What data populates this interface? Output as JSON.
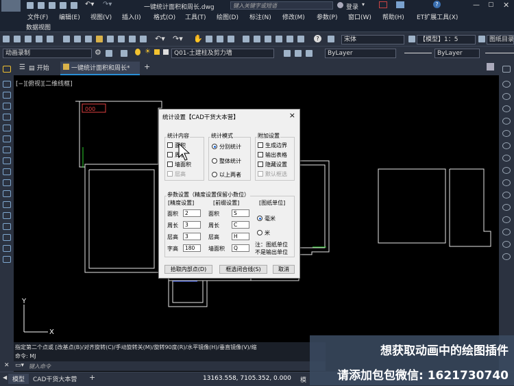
{
  "titlebar": {
    "file_name": "一键统计面积和周长.dwg",
    "search_placeholder": "键入关键字或短语",
    "login": "登录",
    "help_icon": "?"
  },
  "menu": [
    "文件(F)",
    "编辑(E)",
    "视图(V)",
    "插入(I)",
    "格式(O)",
    "工具(T)",
    "绘图(D)",
    "标注(N)",
    "修改(M)",
    "参数(P)",
    "窗口(W)",
    "帮助(H)",
    "ET扩展工具(X)"
  ],
  "submenu": [
    "数据视图"
  ],
  "toolbar": {
    "font_combo": "宋体",
    "model_combo": "【模型】1：5",
    "layer_search": "图纸目录",
    "record_combo": "动画录制",
    "layer_combo": "Q01-土建柱及剪力墙",
    "bylayer_color": "ByLayer",
    "bylayer_linetype": "ByLayer"
  },
  "tabs": {
    "start": "开始",
    "active": "一键统计面积和周长*",
    "add": "+"
  },
  "viewport_label": "[−][俯视][二维线框]",
  "drawing_text": "000",
  "ucs": {
    "x": "X",
    "y": "Y"
  },
  "dialog": {
    "title": "统计设置【CAD干货大本营】",
    "close": "×",
    "group_content": "统计内容",
    "content_items": [
      {
        "label": "面积",
        "checked": false,
        "disabled": false
      },
      {
        "label": "周长",
        "checked": false,
        "disabled": false
      },
      {
        "label": "墙面积",
        "checked": false,
        "disabled": false
      },
      {
        "label": "层高",
        "checked": false,
        "disabled": true
      }
    ],
    "group_mode": "统计模式",
    "mode_items": [
      {
        "label": "分别统计",
        "selected": true
      },
      {
        "label": "整体统计",
        "selected": false
      },
      {
        "label": "以上两者",
        "selected": false
      }
    ],
    "group_extra": "附加设置",
    "extra_items": [
      {
        "label": "生成边界",
        "checked": false,
        "disabled": false
      },
      {
        "label": "输出表格",
        "checked": false,
        "disabled": false
      },
      {
        "label": "隐藏设置",
        "checked": false,
        "disabled": false
      },
      {
        "label": "默认框选",
        "checked": false,
        "disabled": true
      }
    ],
    "group_params": "参数设置（精度设置保留小数位）",
    "precision_header": "[精度设置]",
    "prefix_header": "[前缀设置]",
    "unit_header": "[图纸单位]",
    "rows": [
      {
        "label": "面积",
        "precision": "2",
        "prefix_label": "面积",
        "prefix": "S"
      },
      {
        "label": "周长",
        "precision": "3",
        "prefix_label": "周长",
        "prefix": "C"
      },
      {
        "label": "层高",
        "precision": "3",
        "prefix_label": "层高",
        "prefix": "H"
      },
      {
        "label": "字高",
        "precision": "180",
        "prefix_label": "墙面积",
        "prefix": "Q"
      }
    ],
    "units": [
      {
        "label": "毫米",
        "selected": true
      },
      {
        "label": "米",
        "selected": false
      }
    ],
    "note_line1": "注：图纸单位",
    "note_line2": "不是输出单位",
    "btn_pick": "拾取内部点(D)",
    "btn_select": "框选闭合线(S)",
    "btn_cancel": "取消"
  },
  "command": {
    "history": "指定第二个点或 [改基点(B)/对齐旋转(C)/手动旋转关(M)/旋转90度(R)/水平镜像(H)/垂直镜像(V)/缩",
    "current": "命令: MJ",
    "input_placeholder": "键入命令"
  },
  "status": {
    "model_tab": "模型",
    "layout_tab": "CAD干货大本营",
    "add": "+",
    "coords": "13163.558, 7105.352, 0.000",
    "mode": "模"
  },
  "promo": {
    "line1": "想获取动画中的绘图插件",
    "line2": "请添加包包微信: 1621730740"
  },
  "colors": {
    "bg_dark": "#1b2331",
    "toolbar": "#2b3240",
    "canvas": "#000000",
    "accent": "#1b66d2",
    "drawing_red": "#e04040",
    "drawing_green": "#2bd02b"
  }
}
